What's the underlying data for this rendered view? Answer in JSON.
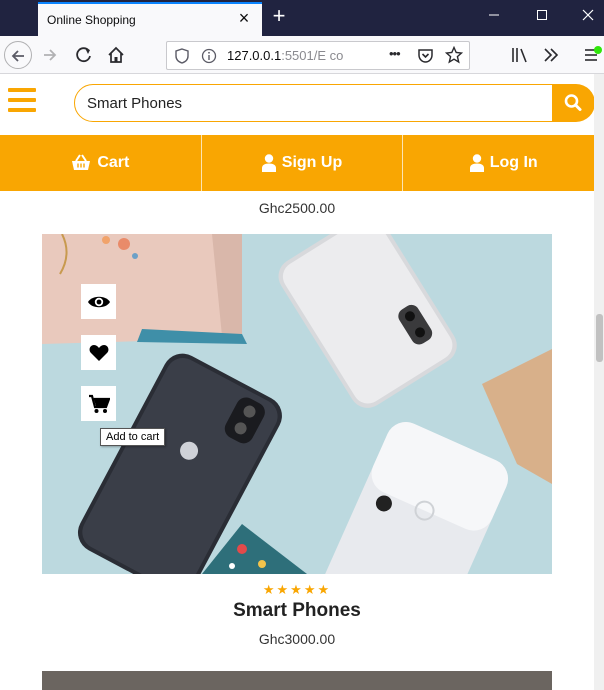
{
  "browser": {
    "tab_title": "Online Shopping",
    "tab_close": "×",
    "new_tab": "+",
    "url_host": "127.0.0.1",
    "url_rest": ":5501/E co",
    "more_icon": "•••"
  },
  "search": {
    "value": "Smart Phones"
  },
  "menu": {
    "cart": "Cart",
    "signup": "Sign Up",
    "login": "Log In"
  },
  "products": {
    "prev_price": "Ghc2500.00",
    "name": "Smart Phones",
    "price": "Ghc3000.00",
    "rating": 5,
    "tooltip": "Add to cart",
    "stars": "★★★★★"
  },
  "colors": {
    "accent": "#f9a602",
    "tab_bar": "#202340"
  }
}
